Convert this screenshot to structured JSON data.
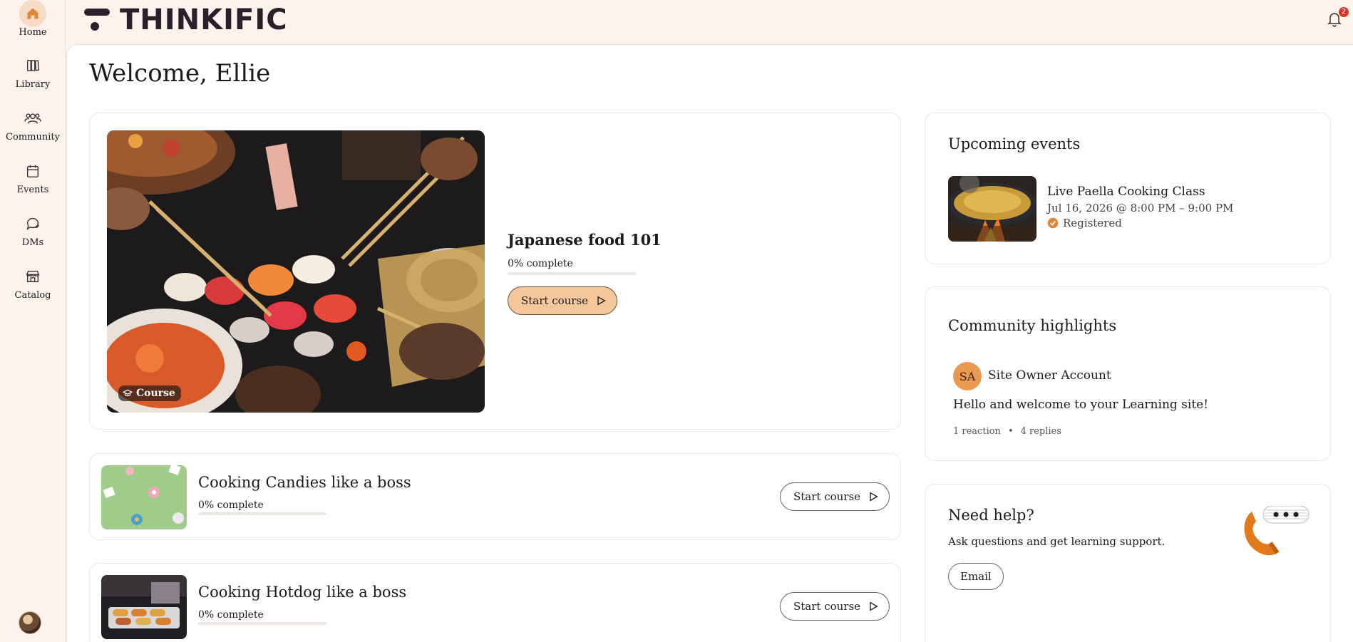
{
  "sidebar": {
    "items": [
      {
        "label": "Home",
        "icon": "home-icon",
        "active": true
      },
      {
        "label": "Library",
        "icon": "library-icon",
        "active": false
      },
      {
        "label": "Community",
        "icon": "community-icon",
        "active": false
      },
      {
        "label": "Events",
        "icon": "calendar-icon",
        "active": false
      },
      {
        "label": "DMs",
        "icon": "chat-icon",
        "active": false
      },
      {
        "label": "Catalog",
        "icon": "store-icon",
        "active": false
      }
    ]
  },
  "header": {
    "logo_text": "THINKIFIC",
    "notification_count": "2"
  },
  "main": {
    "welcome": "Welcome, Ellie",
    "featured_course": {
      "title": "Japanese food 101",
      "progress_text": "0% complete",
      "progress": 0,
      "button_label": "Start course",
      "chip_label": "Course"
    },
    "courses": [
      {
        "title": "Cooking Candies like a boss",
        "progress_text": "0% complete",
        "progress": 0,
        "button_label": "Start course"
      },
      {
        "title": "Cooking Hotdog like a boss",
        "progress_text": "0% complete",
        "progress": 0,
        "button_label": "Start course"
      }
    ]
  },
  "right": {
    "events": {
      "heading": "Upcoming events",
      "title": "Live Paella Cooking Class",
      "datetime": "Jul 16, 2026 @ 8:00 PM – 9:00 PM",
      "status": "Registered"
    },
    "community": {
      "heading": "Community highlights",
      "avatar_initials": "SA",
      "author": "Site Owner Account",
      "post": "Hello and welcome to your Learning site!",
      "reactions": "1 reaction",
      "separator": "•",
      "replies": "4 replies"
    },
    "help": {
      "heading": "Need help?",
      "subtext": "Ask questions and get learning support.",
      "button_label": "Email"
    }
  },
  "colors": {
    "accent": "#e0863b",
    "sidebar_bg": "#fdf3ec",
    "primary_button": "#f5c79b",
    "badge": "#d8352a"
  }
}
